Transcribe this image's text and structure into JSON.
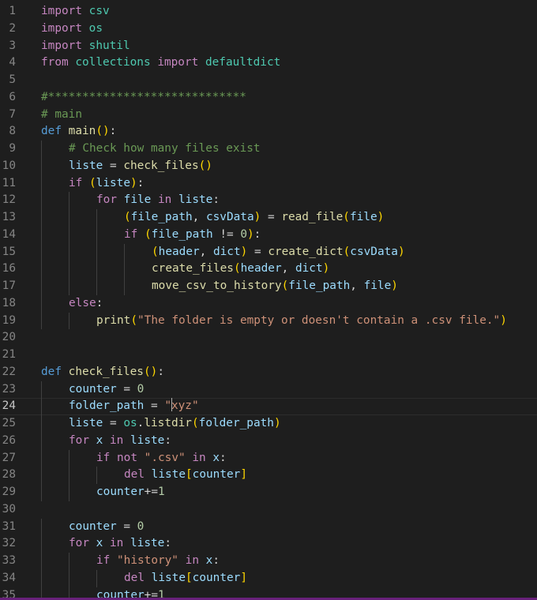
{
  "colors": {
    "background": "#1e1e1e",
    "keyword": "#c586c0",
    "storage": "#569cd6",
    "function": "#dcdcaa",
    "variable": "#9cdcfe",
    "module": "#4ec9b0",
    "string": "#ce9178",
    "number": "#b5cea8",
    "comment": "#6a9955",
    "status_bar": "#68217a"
  },
  "editor": {
    "current_line": 24,
    "lines": [
      {
        "n": "1",
        "indent": 0,
        "tokens": [
          [
            "kw",
            "import"
          ],
          [
            "pl",
            " "
          ],
          [
            "mod",
            "csv"
          ]
        ]
      },
      {
        "n": "2",
        "indent": 0,
        "tokens": [
          [
            "kw",
            "import"
          ],
          [
            "pl",
            " "
          ],
          [
            "mod",
            "os"
          ]
        ]
      },
      {
        "n": "3",
        "indent": 0,
        "tokens": [
          [
            "kw",
            "import"
          ],
          [
            "pl",
            " "
          ],
          [
            "mod",
            "shutil"
          ]
        ]
      },
      {
        "n": "4",
        "indent": 0,
        "tokens": [
          [
            "kw",
            "from"
          ],
          [
            "pl",
            " "
          ],
          [
            "mod",
            "collections"
          ],
          [
            "pl",
            " "
          ],
          [
            "kw",
            "import"
          ],
          [
            "pl",
            " "
          ],
          [
            "mod",
            "defaultdict"
          ]
        ]
      },
      {
        "n": "5",
        "indent": 0,
        "tokens": []
      },
      {
        "n": "6",
        "indent": 0,
        "tokens": [
          [
            "com",
            "#*****************************"
          ]
        ]
      },
      {
        "n": "7",
        "indent": 0,
        "tokens": [
          [
            "com",
            "# main"
          ]
        ]
      },
      {
        "n": "8",
        "indent": 0,
        "tokens": [
          [
            "st",
            "def"
          ],
          [
            "pl",
            " "
          ],
          [
            "fn",
            "main"
          ],
          [
            "b1",
            "()"
          ],
          [
            "pl",
            ":"
          ]
        ]
      },
      {
        "n": "9",
        "indent": 1,
        "tokens": [
          [
            "com",
            "# Check how many files exist"
          ]
        ]
      },
      {
        "n": "10",
        "indent": 1,
        "tokens": [
          [
            "var",
            "liste"
          ],
          [
            "pl",
            " = "
          ],
          [
            "fn",
            "check_files"
          ],
          [
            "b1",
            "()"
          ]
        ]
      },
      {
        "n": "11",
        "indent": 1,
        "tokens": [
          [
            "kw",
            "if"
          ],
          [
            "pl",
            " "
          ],
          [
            "b1",
            "("
          ],
          [
            "var",
            "liste"
          ],
          [
            "b1",
            ")"
          ],
          [
            "pl",
            ":"
          ]
        ]
      },
      {
        "n": "12",
        "indent": 2,
        "tokens": [
          [
            "kw",
            "for"
          ],
          [
            "pl",
            " "
          ],
          [
            "var",
            "file"
          ],
          [
            "pl",
            " "
          ],
          [
            "kw",
            "in"
          ],
          [
            "pl",
            " "
          ],
          [
            "var",
            "liste"
          ],
          [
            "pl",
            ":"
          ]
        ]
      },
      {
        "n": "13",
        "indent": 3,
        "tokens": [
          [
            "b1",
            "("
          ],
          [
            "var",
            "file_path"
          ],
          [
            "pl",
            ", "
          ],
          [
            "var",
            "csvData"
          ],
          [
            "b1",
            ")"
          ],
          [
            "pl",
            " = "
          ],
          [
            "fn",
            "read_file"
          ],
          [
            "b1",
            "("
          ],
          [
            "var",
            "file"
          ],
          [
            "b1",
            ")"
          ]
        ]
      },
      {
        "n": "14",
        "indent": 3,
        "tokens": [
          [
            "kw",
            "if"
          ],
          [
            "pl",
            " "
          ],
          [
            "b1",
            "("
          ],
          [
            "var",
            "file_path"
          ],
          [
            "pl",
            " != "
          ],
          [
            "num",
            "0"
          ],
          [
            "b1",
            ")"
          ],
          [
            "pl",
            ":"
          ]
        ]
      },
      {
        "n": "15",
        "indent": 4,
        "tokens": [
          [
            "b1",
            "("
          ],
          [
            "var",
            "header"
          ],
          [
            "pl",
            ", "
          ],
          [
            "var",
            "dict"
          ],
          [
            "b1",
            ")"
          ],
          [
            "pl",
            " = "
          ],
          [
            "fn",
            "create_dict"
          ],
          [
            "b1",
            "("
          ],
          [
            "var",
            "csvData"
          ],
          [
            "b1",
            ")"
          ]
        ]
      },
      {
        "n": "16",
        "indent": 4,
        "tokens": [
          [
            "fn",
            "create_files"
          ],
          [
            "b1",
            "("
          ],
          [
            "var",
            "header"
          ],
          [
            "pl",
            ", "
          ],
          [
            "var",
            "dict"
          ],
          [
            "b1",
            ")"
          ]
        ]
      },
      {
        "n": "17",
        "indent": 4,
        "tokens": [
          [
            "fn",
            "move_csv_to_history"
          ],
          [
            "b1",
            "("
          ],
          [
            "var",
            "file_path"
          ],
          [
            "pl",
            ", "
          ],
          [
            "var",
            "file"
          ],
          [
            "b1",
            ")"
          ]
        ]
      },
      {
        "n": "18",
        "indent": 1,
        "tokens": [
          [
            "kw",
            "else"
          ],
          [
            "pl",
            ":"
          ]
        ]
      },
      {
        "n": "19",
        "indent": 2,
        "tokens": [
          [
            "fn",
            "print"
          ],
          [
            "b1",
            "("
          ],
          [
            "str",
            "\"The folder is empty or doesn't contain a .csv file.\""
          ],
          [
            "b1",
            ")"
          ]
        ]
      },
      {
        "n": "20",
        "indent": 0,
        "tokens": []
      },
      {
        "n": "21",
        "indent": 0,
        "tokens": []
      },
      {
        "n": "22",
        "indent": 0,
        "tokens": [
          [
            "st",
            "def"
          ],
          [
            "pl",
            " "
          ],
          [
            "fn",
            "check_files"
          ],
          [
            "b1",
            "()"
          ],
          [
            "pl",
            ":"
          ]
        ]
      },
      {
        "n": "23",
        "indent": 1,
        "tokens": [
          [
            "var",
            "counter"
          ],
          [
            "pl",
            " = "
          ],
          [
            "num",
            "0"
          ]
        ]
      },
      {
        "n": "24",
        "indent": 1,
        "tokens": [
          [
            "var",
            "folder_path"
          ],
          [
            "pl",
            " = "
          ],
          [
            "str",
            "\""
          ],
          [
            "cursor",
            ""
          ],
          [
            "str",
            "xyz\""
          ]
        ]
      },
      {
        "n": "25",
        "indent": 1,
        "tokens": [
          [
            "var",
            "liste"
          ],
          [
            "pl",
            " = "
          ],
          [
            "mod",
            "os"
          ],
          [
            "pl",
            "."
          ],
          [
            "fn",
            "listdir"
          ],
          [
            "b1",
            "("
          ],
          [
            "var",
            "folder_path"
          ],
          [
            "b1",
            ")"
          ]
        ]
      },
      {
        "n": "26",
        "indent": 1,
        "tokens": [
          [
            "kw",
            "for"
          ],
          [
            "pl",
            " "
          ],
          [
            "var",
            "x"
          ],
          [
            "pl",
            " "
          ],
          [
            "kw",
            "in"
          ],
          [
            "pl",
            " "
          ],
          [
            "var",
            "liste"
          ],
          [
            "pl",
            ":"
          ]
        ]
      },
      {
        "n": "27",
        "indent": 2,
        "tokens": [
          [
            "kw",
            "if"
          ],
          [
            "pl",
            " "
          ],
          [
            "kw",
            "not"
          ],
          [
            "pl",
            " "
          ],
          [
            "str",
            "\".csv\""
          ],
          [
            "pl",
            " "
          ],
          [
            "kw",
            "in"
          ],
          [
            "pl",
            " "
          ],
          [
            "var",
            "x"
          ],
          [
            "pl",
            ":"
          ]
        ]
      },
      {
        "n": "28",
        "indent": 3,
        "tokens": [
          [
            "kw",
            "del"
          ],
          [
            "pl",
            " "
          ],
          [
            "var",
            "liste"
          ],
          [
            "b1",
            "["
          ],
          [
            "var",
            "counter"
          ],
          [
            "b1",
            "]"
          ]
        ]
      },
      {
        "n": "29",
        "indent": 2,
        "tokens": [
          [
            "var",
            "counter"
          ],
          [
            "pl",
            "+="
          ],
          [
            "num",
            "1"
          ]
        ]
      },
      {
        "n": "30",
        "indent": 0,
        "tokens": []
      },
      {
        "n": "31",
        "indent": 1,
        "tokens": [
          [
            "var",
            "counter"
          ],
          [
            "pl",
            " = "
          ],
          [
            "num",
            "0"
          ]
        ]
      },
      {
        "n": "32",
        "indent": 1,
        "tokens": [
          [
            "kw",
            "for"
          ],
          [
            "pl",
            " "
          ],
          [
            "var",
            "x"
          ],
          [
            "pl",
            " "
          ],
          [
            "kw",
            "in"
          ],
          [
            "pl",
            " "
          ],
          [
            "var",
            "liste"
          ],
          [
            "pl",
            ":"
          ]
        ]
      },
      {
        "n": "33",
        "indent": 2,
        "tokens": [
          [
            "kw",
            "if"
          ],
          [
            "pl",
            " "
          ],
          [
            "str",
            "\"history\""
          ],
          [
            "pl",
            " "
          ],
          [
            "kw",
            "in"
          ],
          [
            "pl",
            " "
          ],
          [
            "var",
            "x"
          ],
          [
            "pl",
            ":"
          ]
        ]
      },
      {
        "n": "34",
        "indent": 3,
        "tokens": [
          [
            "kw",
            "del"
          ],
          [
            "pl",
            " "
          ],
          [
            "var",
            "liste"
          ],
          [
            "b1",
            "["
          ],
          [
            "var",
            "counter"
          ],
          [
            "b1",
            "]"
          ]
        ]
      },
      {
        "n": "35",
        "indent": 2,
        "tokens": [
          [
            "var",
            "counter"
          ],
          [
            "pl",
            "+="
          ],
          [
            "num",
            "1"
          ]
        ]
      }
    ]
  }
}
